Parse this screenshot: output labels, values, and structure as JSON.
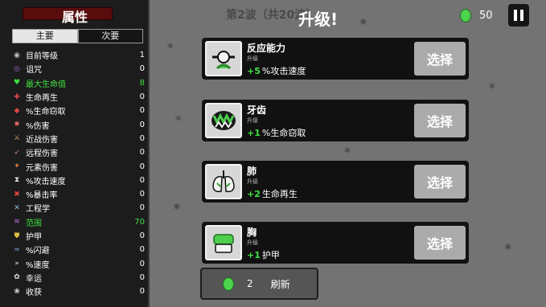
{
  "stats_panel": {
    "title": "属性",
    "tabs": [
      {
        "label": "主要",
        "active": true
      },
      {
        "label": "次要",
        "active": false
      }
    ],
    "items": [
      {
        "icon": "level-icon",
        "label": "目前等级",
        "value": "1",
        "highlight": false
      },
      {
        "icon": "curse-icon",
        "label": "诅咒",
        "value": "0",
        "highlight": false
      },
      {
        "icon": "heart-icon",
        "label": "最大生命值",
        "value": "8",
        "highlight": true
      },
      {
        "icon": "regen-icon",
        "label": "生命再生",
        "value": "0",
        "highlight": false
      },
      {
        "icon": "steal-icon",
        "label": "%生命窃取",
        "value": "0",
        "highlight": false
      },
      {
        "icon": "damage-icon",
        "label": "%伤害",
        "value": "0",
        "highlight": false
      },
      {
        "icon": "melee-icon",
        "label": "近战伤害",
        "value": "0",
        "highlight": false
      },
      {
        "icon": "ranged-icon",
        "label": "远程伤害",
        "value": "0",
        "highlight": false
      },
      {
        "icon": "elemental-icon",
        "label": "元素伤害",
        "value": "0",
        "highlight": false
      },
      {
        "icon": "attack-speed-icon",
        "label": "%攻击速度",
        "value": "0",
        "highlight": false
      },
      {
        "icon": "crit-icon",
        "label": "%暴击率",
        "value": "0",
        "highlight": false
      },
      {
        "icon": "engineering-icon",
        "label": "工程学",
        "value": "0",
        "highlight": false
      },
      {
        "icon": "range-icon",
        "label": "范围",
        "value": "70",
        "highlight": true
      },
      {
        "icon": "armor-icon",
        "label": "护甲",
        "value": "0",
        "highlight": false
      },
      {
        "icon": "dodge-icon",
        "label": "%闪避",
        "value": "0",
        "highlight": false
      },
      {
        "icon": "speed-icon",
        "label": "%速度",
        "value": "0",
        "highlight": false
      },
      {
        "icon": "luck-icon",
        "label": "幸运",
        "value": "0",
        "highlight": false
      },
      {
        "icon": "harvest-icon",
        "label": "收获",
        "value": "0",
        "highlight": false
      }
    ]
  },
  "header": {
    "wave": "第2波（共20波）",
    "title": "升级!",
    "materials": "50"
  },
  "upgrades": [
    {
      "icon": "reflex-icon",
      "name": "反应能力",
      "sub": "升级",
      "amount": "+5",
      "effect": "%攻击速度",
      "button": "选择"
    },
    {
      "icon": "teeth-icon",
      "name": "牙齿",
      "sub": "升级",
      "amount": "+1",
      "effect": "%生命窃取",
      "button": "选择"
    },
    {
      "icon": "lungs-icon",
      "name": "肺",
      "sub": "升级",
      "amount": "+2",
      "effect": "生命再生",
      "button": "选择"
    },
    {
      "icon": "chest-icon",
      "name": "胸",
      "sub": "升级",
      "amount": "+1",
      "effect": "护甲",
      "button": "选择"
    }
  ],
  "reroll": {
    "cost": "2",
    "label": "刷新"
  },
  "colors": {
    "accent_green": "#40e040",
    "panel": "#1c1c1c",
    "button": "#ababab"
  }
}
